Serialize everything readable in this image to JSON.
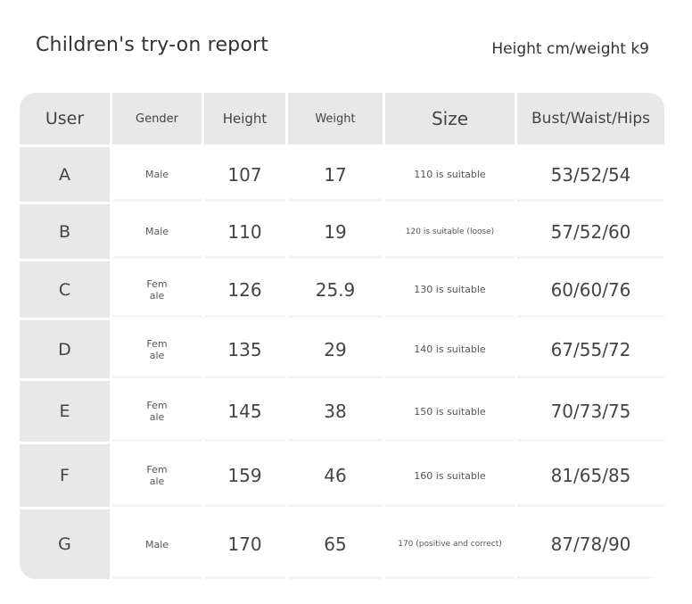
{
  "header": {
    "title": "Children's try-on report",
    "unit_label": "Height cm/weight k9"
  },
  "table": {
    "columns": [
      "User",
      "Gender",
      "Height",
      "Weight",
      "Size",
      "Bust/Waist/Hips"
    ],
    "rows": [
      {
        "user": "A",
        "gender": "Male",
        "height": "107",
        "weight": "17",
        "size": "110 is suitable",
        "measurements": "53/52/54"
      },
      {
        "user": "B",
        "gender": "Male",
        "height": "110",
        "weight": "19",
        "size": "120 is suitable (loose)",
        "measurements": "57/52/60"
      },
      {
        "user": "C",
        "gender": "Fem\nale",
        "height": "126",
        "weight": "25.9",
        "size": "130 is suitable",
        "measurements": "60/60/76"
      },
      {
        "user": "D",
        "gender": "Fem\nale",
        "height": "135",
        "weight": "29",
        "size": "140 is suitable",
        "measurements": "67/55/72"
      },
      {
        "user": "E",
        "gender": "Fem\nale",
        "height": "145",
        "weight": "38",
        "size": "150 is suitable",
        "measurements": "70/73/75"
      },
      {
        "user": "F",
        "gender": "Fem\nale",
        "height": "159",
        "weight": "46",
        "size": "160 is suitable",
        "measurements": "81/65/85"
      },
      {
        "user": "G",
        "gender": "Male",
        "height": "170",
        "weight": "65",
        "size": "170 (positive and correct)",
        "measurements": "87/78/90"
      }
    ]
  },
  "colors": {
    "header_bg": "#e8e8e8",
    "separator": "#f4f4f4",
    "text": "#444444"
  }
}
